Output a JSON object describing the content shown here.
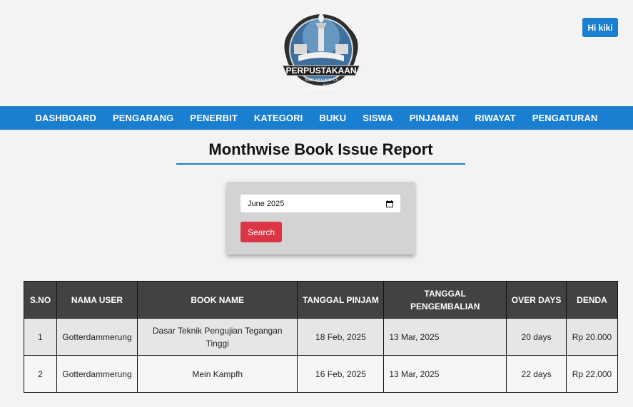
{
  "header": {
    "logo_text": {
      "line1": "PERPUSTAKAAN",
      "line2": "SMP NEGERI 13",
      "line3": "KOTA",
      "line4": "KOTA MAGELANG"
    },
    "user_button": "Hi kiki"
  },
  "nav": {
    "items": [
      "DASHBOARD",
      "PENGARANG",
      "PENERBIT",
      "KATEGORI",
      "BUKU",
      "SISWA",
      "PINJAMAN",
      "RIWAYAT",
      "PENGATURAN"
    ]
  },
  "page": {
    "title": "Monthwise Book Issue Report"
  },
  "search": {
    "month_value": "June 2025",
    "button_label": "Search"
  },
  "table": {
    "headers": [
      "S.NO",
      "NAMA USER",
      "BOOK NAME",
      "TANGGAL PINJAM",
      "TANGGAL PENGEMBALIAN",
      "OVER DAYS",
      "DENDA"
    ],
    "rows": [
      [
        "1",
        "Gotterdammerung",
        "Dasar Teknik Pengujian Tegangan Tinggi",
        "18 Feb, 2025",
        "13 Mar, 2025",
        "20 days",
        "Rp 20.000"
      ],
      [
        "2",
        "Gotterdammerung",
        "Mein Kampfh",
        "16 Feb, 2025",
        "13 Mar, 2025",
        "22 days",
        "Rp 22.000"
      ]
    ]
  },
  "colors": {
    "accent": "#1b7fd1",
    "danger": "#dc3545",
    "table_header": "#424242"
  }
}
